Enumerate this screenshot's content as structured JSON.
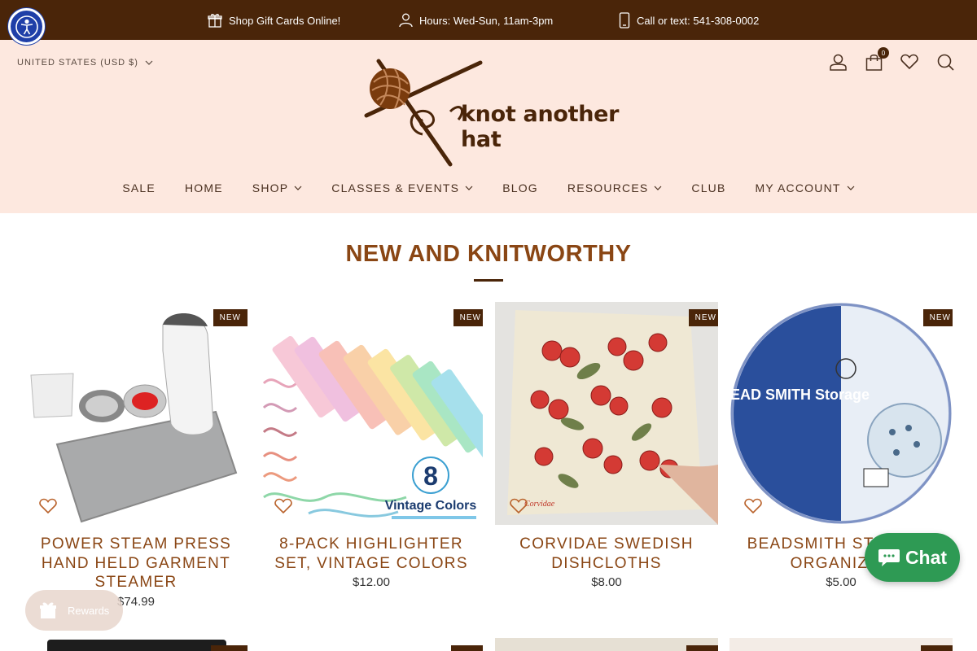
{
  "announcements": [
    {
      "text": "Shop Gift Cards Online!",
      "icon": "gift-icon"
    },
    {
      "text": "Hours: Wed-Sun, 11am-3pm",
      "icon": "person-icon"
    },
    {
      "text": "Call or text: 541-308-0002",
      "icon": "phone-icon"
    }
  ],
  "header": {
    "currency": "UNITED STATES (USD $)",
    "logo_text": "knot another hat",
    "cart_count": "0"
  },
  "nav": {
    "items": [
      "SALE",
      "HOME",
      "SHOP",
      "CLASSES & EVENTS",
      "BLOG",
      "RESOURCES",
      "CLUB",
      "MY ACCOUNT"
    ]
  },
  "section": {
    "title": "NEW AND KNITWORTHY"
  },
  "products": [
    {
      "badge": "NEW",
      "name": "POWER STEAM PRESS HAND HELD GARMENT STEAMER",
      "price": "$74.99"
    },
    {
      "badge": "NEW",
      "name": "8-PACK HIGHLIGHTER SET, VINTAGE COLORS",
      "price": "$12.00",
      "image_text": "8",
      "image_caption": "Vintage Colors"
    },
    {
      "badge": "NEW",
      "name": "CORVIDAE SWEDISH DISHCLOTHS",
      "price": "$8.00",
      "image_caption": "Corvidae"
    },
    {
      "badge": "NEW",
      "name": "BEADSMITH STORAGE ORGANIZER",
      "price": "$5.00",
      "image_text": "BEAD SMITH Storage"
    }
  ],
  "widgets": {
    "chat_label": "Chat",
    "rewards_label": "Rewards"
  },
  "colors": {
    "topbar": "#4a2509",
    "header_bg": "#fde8df",
    "accent": "#8a4614",
    "chat": "#2e9a54"
  }
}
